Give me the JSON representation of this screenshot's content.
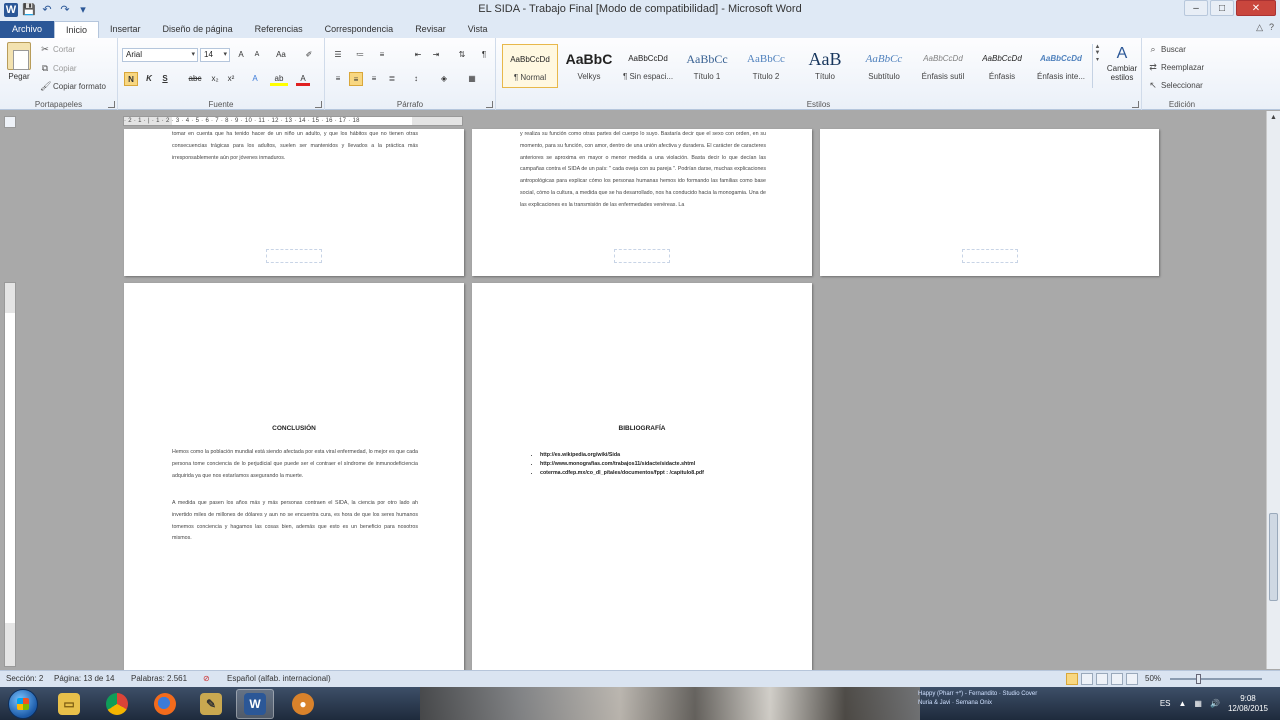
{
  "window": {
    "title": "EL SIDA - Trabajo Final [Modo de compatibilidad] - Microsoft Word",
    "controls": {
      "minimize": "–",
      "maximize": "□",
      "close": "✕"
    }
  },
  "tabs": [
    {
      "label": "Archivo"
    },
    {
      "label": "Inicio"
    },
    {
      "label": "Insertar"
    },
    {
      "label": "Diseño de página"
    },
    {
      "label": "Referencias"
    },
    {
      "label": "Correspondencia"
    },
    {
      "label": "Revisar"
    },
    {
      "label": "Vista"
    }
  ],
  "ribbon": {
    "clipboard": {
      "paste": "Pegar",
      "cut": "Cortar",
      "copy": "Copiar",
      "format_painter": "Copiar formato",
      "label": "Portapapeles"
    },
    "font": {
      "family": "Arial",
      "size": "14",
      "label": "Fuente",
      "buttons": {
        "grow": "A",
        "shrink": "A",
        "case": "Aa",
        "clear": "✐",
        "bold": "N",
        "italic": "K",
        "underline": "S",
        "strike": "abc",
        "sub": "x₂",
        "sup": "x²",
        "effects": "A",
        "highlight": "ab",
        "color": "A"
      }
    },
    "paragraph": {
      "label": "Párrafo",
      "show_marks": "¶"
    },
    "styles": {
      "label": "Estilos",
      "items": [
        {
          "sample": "AaBbCcDd",
          "name": "¶ Normal"
        },
        {
          "sample": "AaBbC",
          "name": "Velkys"
        },
        {
          "sample": "AaBbCcDd",
          "name": "¶ Sin espaci..."
        },
        {
          "sample": "AaBbCc",
          "name": "Título 1"
        },
        {
          "sample": "AaBbCc",
          "name": "Título 2"
        },
        {
          "sample": "AaB",
          "name": "Título"
        },
        {
          "sample": "AaBbCc",
          "name": "Subtítulo"
        },
        {
          "sample": "AaBbCcDd",
          "name": "Énfasis sutil"
        },
        {
          "sample": "AaBbCcDd",
          "name": "Énfasis"
        },
        {
          "sample": "AaBbCcDd",
          "name": "Énfasis inte..."
        }
      ],
      "change": "Cambiar estilos"
    },
    "editing": {
      "label": "Edición",
      "find": "Buscar",
      "replace": "Reemplazar",
      "select": "Seleccionar"
    }
  },
  "ruler": {
    "numbers": "· 2 · 1 · | · 1 · 2 · 3 · 4 · 5 · 6 · 7 · 8 · 9 · 10 · 11 · 12 · 13 · 14 · 15 · 16 · 17 · 18"
  },
  "pages": {
    "p1_text": "tomar en cuenta que ha tenido hacer de un niño un adulto, y que los hábitos que no tienen otras consecuencias trágicas para los adultos, suelen ser mantenidos y llevados a la práctica más irresponsablemente aún por jóvenes inmaduros.",
    "p2_text": "y realiza su función como otras partes del cuerpo lo suyo. Bastaría decir que el sexo con orden, en su momento, para su función, con amor, dentro de una unión afectiva y duradera. El carácter de caracteres anteriores se aproxima en mayor o menor medida a una violación. Basta decir lo que decían las campañas contra el SIDA de un país: \" cada oveja con su pareja \". Podrían darse, muchas explicaciones antropológicas para explicar cómo los personas humanas hemos ido formando las familias como base social, cómo la cultura, a medida que se ha desarrollado, nos ha conducido hacia la monogamia. Una de las explicaciones es la transmisión de las enfermedades venéreas. La",
    "conclusion_title": "CONCLUSIÓN",
    "conclusion_p1": "Hemos como la población mundial está siendo afectada por esta viral enfermedad, lo mejor es que cada persona tome conciencia de lo perjudicial que puede ser el contraer el síndrome de inmunodeficiencia adquirida ya que nos estaríamos asegurando la muerte.",
    "conclusion_p2": "A medida que pasen los años más y más personas contraen el SIDA, la ciencia por otro lado ah invertido miles de millones de dólares y aun no se encuentra cura, es hora de que los seres humanos tomemos conciencia y hagamos las cosas bien, además que esto es un beneficio para nosotros mismos.",
    "bibliography_title": "BIBLIOGRAFÍA",
    "bibliography": [
      "http://es.wikipedia.org/wiki/Sida",
      "http://www.monografias.com/trabajos11/sidacte/sidacte.shtml",
      "coterma.cdfep.mx/co_dl_p/tales/documentos/fppt : /capitulo8.pdf"
    ]
  },
  "status": {
    "section": "Sección: 2",
    "page": "Página: 13 de 14",
    "words": "Palabras: 2.561",
    "language": "Español (alfab. internacional)",
    "zoom": "50%"
  },
  "taskbar": {
    "lang": "ES",
    "time": "9:08",
    "date": "12/08/2015",
    "notif_1": "Happy (Pharr +*) - Fernandito · Studio Cover",
    "notif_2": "Nuria & Javi · Semana Onix"
  }
}
